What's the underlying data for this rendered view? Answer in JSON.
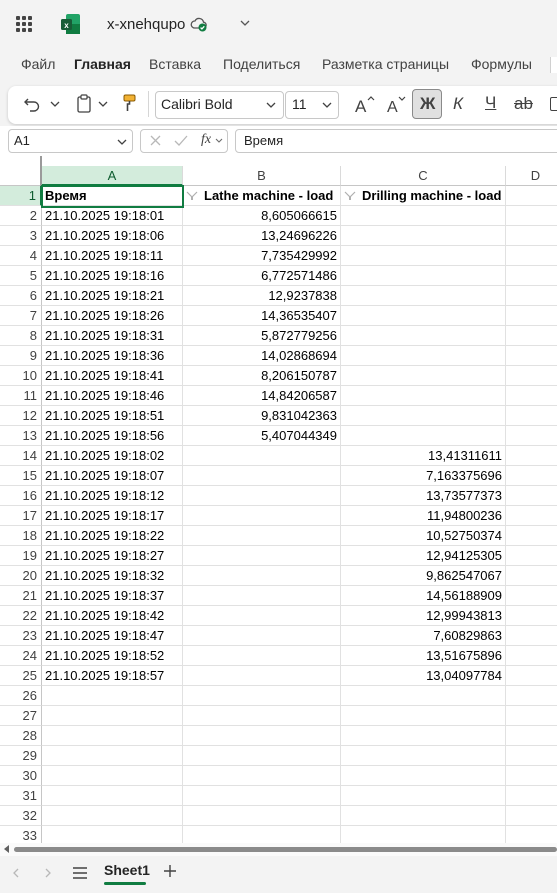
{
  "header": {
    "file_title": "x-xnehqupo"
  },
  "tabs": [
    "Файл",
    "Главная",
    "Вставка",
    "Поделиться",
    "Разметка страницы",
    "Формулы"
  ],
  "active_tab": "Главная",
  "toolbar": {
    "font_name": "Calibri Bold",
    "font_size": "11",
    "bold_label": "Ж",
    "italic_label": "К",
    "underline_label": "Ч",
    "strike_label": "ab"
  },
  "formula_bar": {
    "name_box": "A1",
    "fx_label": "fx",
    "formula": "Время"
  },
  "columns": [
    "A",
    "B",
    "C",
    "D"
  ],
  "selected_cell": "A1",
  "header_row": [
    "Время",
    "Lathe machine - load",
    "Drilling machine - load"
  ],
  "rows": [
    {
      "n": "2",
      "a": "21.10.2025 19:18:01",
      "b": "8,605066615",
      "c": ""
    },
    {
      "n": "3",
      "a": "21.10.2025 19:18:06",
      "b": "13,24696226",
      "c": ""
    },
    {
      "n": "4",
      "a": "21.10.2025 19:18:11",
      "b": "7,735429992",
      "c": ""
    },
    {
      "n": "5",
      "a": "21.10.2025 19:18:16",
      "b": "6,772571486",
      "c": ""
    },
    {
      "n": "6",
      "a": "21.10.2025 19:18:21",
      "b": "12,9237838",
      "c": ""
    },
    {
      "n": "7",
      "a": "21.10.2025 19:18:26",
      "b": "14,36535407",
      "c": ""
    },
    {
      "n": "8",
      "a": "21.10.2025 19:18:31",
      "b": "5,872779256",
      "c": ""
    },
    {
      "n": "9",
      "a": "21.10.2025 19:18:36",
      "b": "14,02868694",
      "c": ""
    },
    {
      "n": "10",
      "a": "21.10.2025 19:18:41",
      "b": "8,206150787",
      "c": ""
    },
    {
      "n": "11",
      "a": "21.10.2025 19:18:46",
      "b": "14,84206587",
      "c": ""
    },
    {
      "n": "12",
      "a": "21.10.2025 19:18:51",
      "b": "9,831042363",
      "c": ""
    },
    {
      "n": "13",
      "a": "21.10.2025 19:18:56",
      "b": "5,407044349",
      "c": ""
    },
    {
      "n": "14",
      "a": "21.10.2025 19:18:02",
      "b": "",
      "c": "13,41311611"
    },
    {
      "n": "15",
      "a": "21.10.2025 19:18:07",
      "b": "",
      "c": "7,163375696"
    },
    {
      "n": "16",
      "a": "21.10.2025 19:18:12",
      "b": "",
      "c": "13,73577373"
    },
    {
      "n": "17",
      "a": "21.10.2025 19:18:17",
      "b": "",
      "c": "11,94800236"
    },
    {
      "n": "18",
      "a": "21.10.2025 19:18:22",
      "b": "",
      "c": "10,52750374"
    },
    {
      "n": "19",
      "a": "21.10.2025 19:18:27",
      "b": "",
      "c": "12,94125305"
    },
    {
      "n": "20",
      "a": "21.10.2025 19:18:32",
      "b": "",
      "c": "9,862547067"
    },
    {
      "n": "21",
      "a": "21.10.2025 19:18:37",
      "b": "",
      "c": "14,56188909"
    },
    {
      "n": "22",
      "a": "21.10.2025 19:18:42",
      "b": "",
      "c": "12,99943813"
    },
    {
      "n": "23",
      "a": "21.10.2025 19:18:47",
      "b": "",
      "c": "7,60829863"
    },
    {
      "n": "24",
      "a": "21.10.2025 19:18:52",
      "b": "",
      "c": "13,51675896"
    },
    {
      "n": "25",
      "a": "21.10.2025 19:18:57",
      "b": "",
      "c": "13,04097784"
    },
    {
      "n": "26",
      "a": "",
      "b": "",
      "c": ""
    },
    {
      "n": "27",
      "a": "",
      "b": "",
      "c": ""
    },
    {
      "n": "28",
      "a": "",
      "b": "",
      "c": ""
    },
    {
      "n": "29",
      "a": "",
      "b": "",
      "c": ""
    },
    {
      "n": "30",
      "a": "",
      "b": "",
      "c": ""
    },
    {
      "n": "31",
      "a": "",
      "b": "",
      "c": ""
    },
    {
      "n": "32",
      "a": "",
      "b": "",
      "c": ""
    },
    {
      "n": "33",
      "a": "",
      "b": "",
      "c": ""
    }
  ],
  "sheets": {
    "active": "Sheet1"
  },
  "colors": {
    "accent": "#107c41",
    "selected_header": "#d3ecdc"
  },
  "icons": [
    "app-launcher-icon",
    "excel-logo-icon",
    "cloud-saved-icon",
    "chevron-down-icon",
    "undo-icon",
    "clipboard-icon",
    "format-painter-icon",
    "grow-font-icon",
    "shrink-font-icon",
    "filter-icon",
    "add-sheet-icon",
    "sheet-list-icon"
  ]
}
